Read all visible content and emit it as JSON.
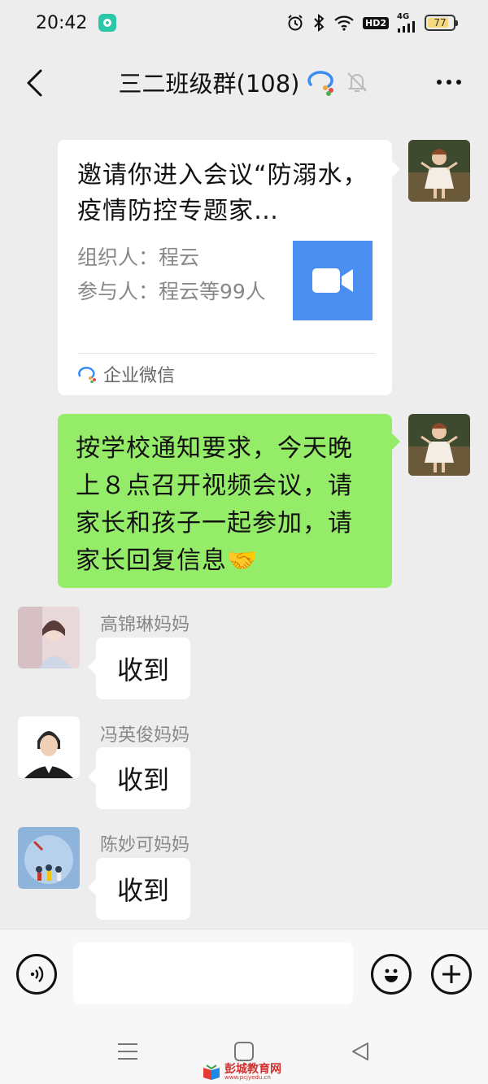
{
  "status_bar": {
    "time": "20:42",
    "network_label": "4G",
    "hd_label": "HD2",
    "battery_level": "77"
  },
  "header": {
    "title": "三二班级群(108)"
  },
  "messages": {
    "meeting_card": {
      "title": "邀请你进入会议“防溺水，疫情防控专题家…",
      "organizer": "组织人：程云",
      "participants": "参与人：程云等99人",
      "source": "企业微信"
    },
    "notice": "按学校通知要求，今天晚上８点召开视频会议，请家长和孩子一起参加，请家长回复信息🤝",
    "replies": [
      {
        "sender": "高锦琳妈妈",
        "text": "收到"
      },
      {
        "sender": "冯英俊妈妈",
        "text": "收到"
      },
      {
        "sender": "陈妙可妈妈",
        "text": "收到"
      }
    ]
  },
  "input": {
    "value": "",
    "placeholder": ""
  },
  "watermark": {
    "text": "彭城教育网",
    "url": "www.pcjyedu.cn"
  },
  "icons": {
    "back": "back-arrow-icon",
    "group": "group-chat-icon",
    "mute": "mute-bell-icon",
    "more": "more-icon",
    "voice": "voice-icon",
    "emoji": "emoji-icon",
    "plus": "plus-icon",
    "video": "video-camera-icon"
  },
  "colors": {
    "background": "#ededed",
    "self_bubble": "#95ec69",
    "other_bubble": "#ffffff",
    "video_tile": "#4a8ff0"
  }
}
